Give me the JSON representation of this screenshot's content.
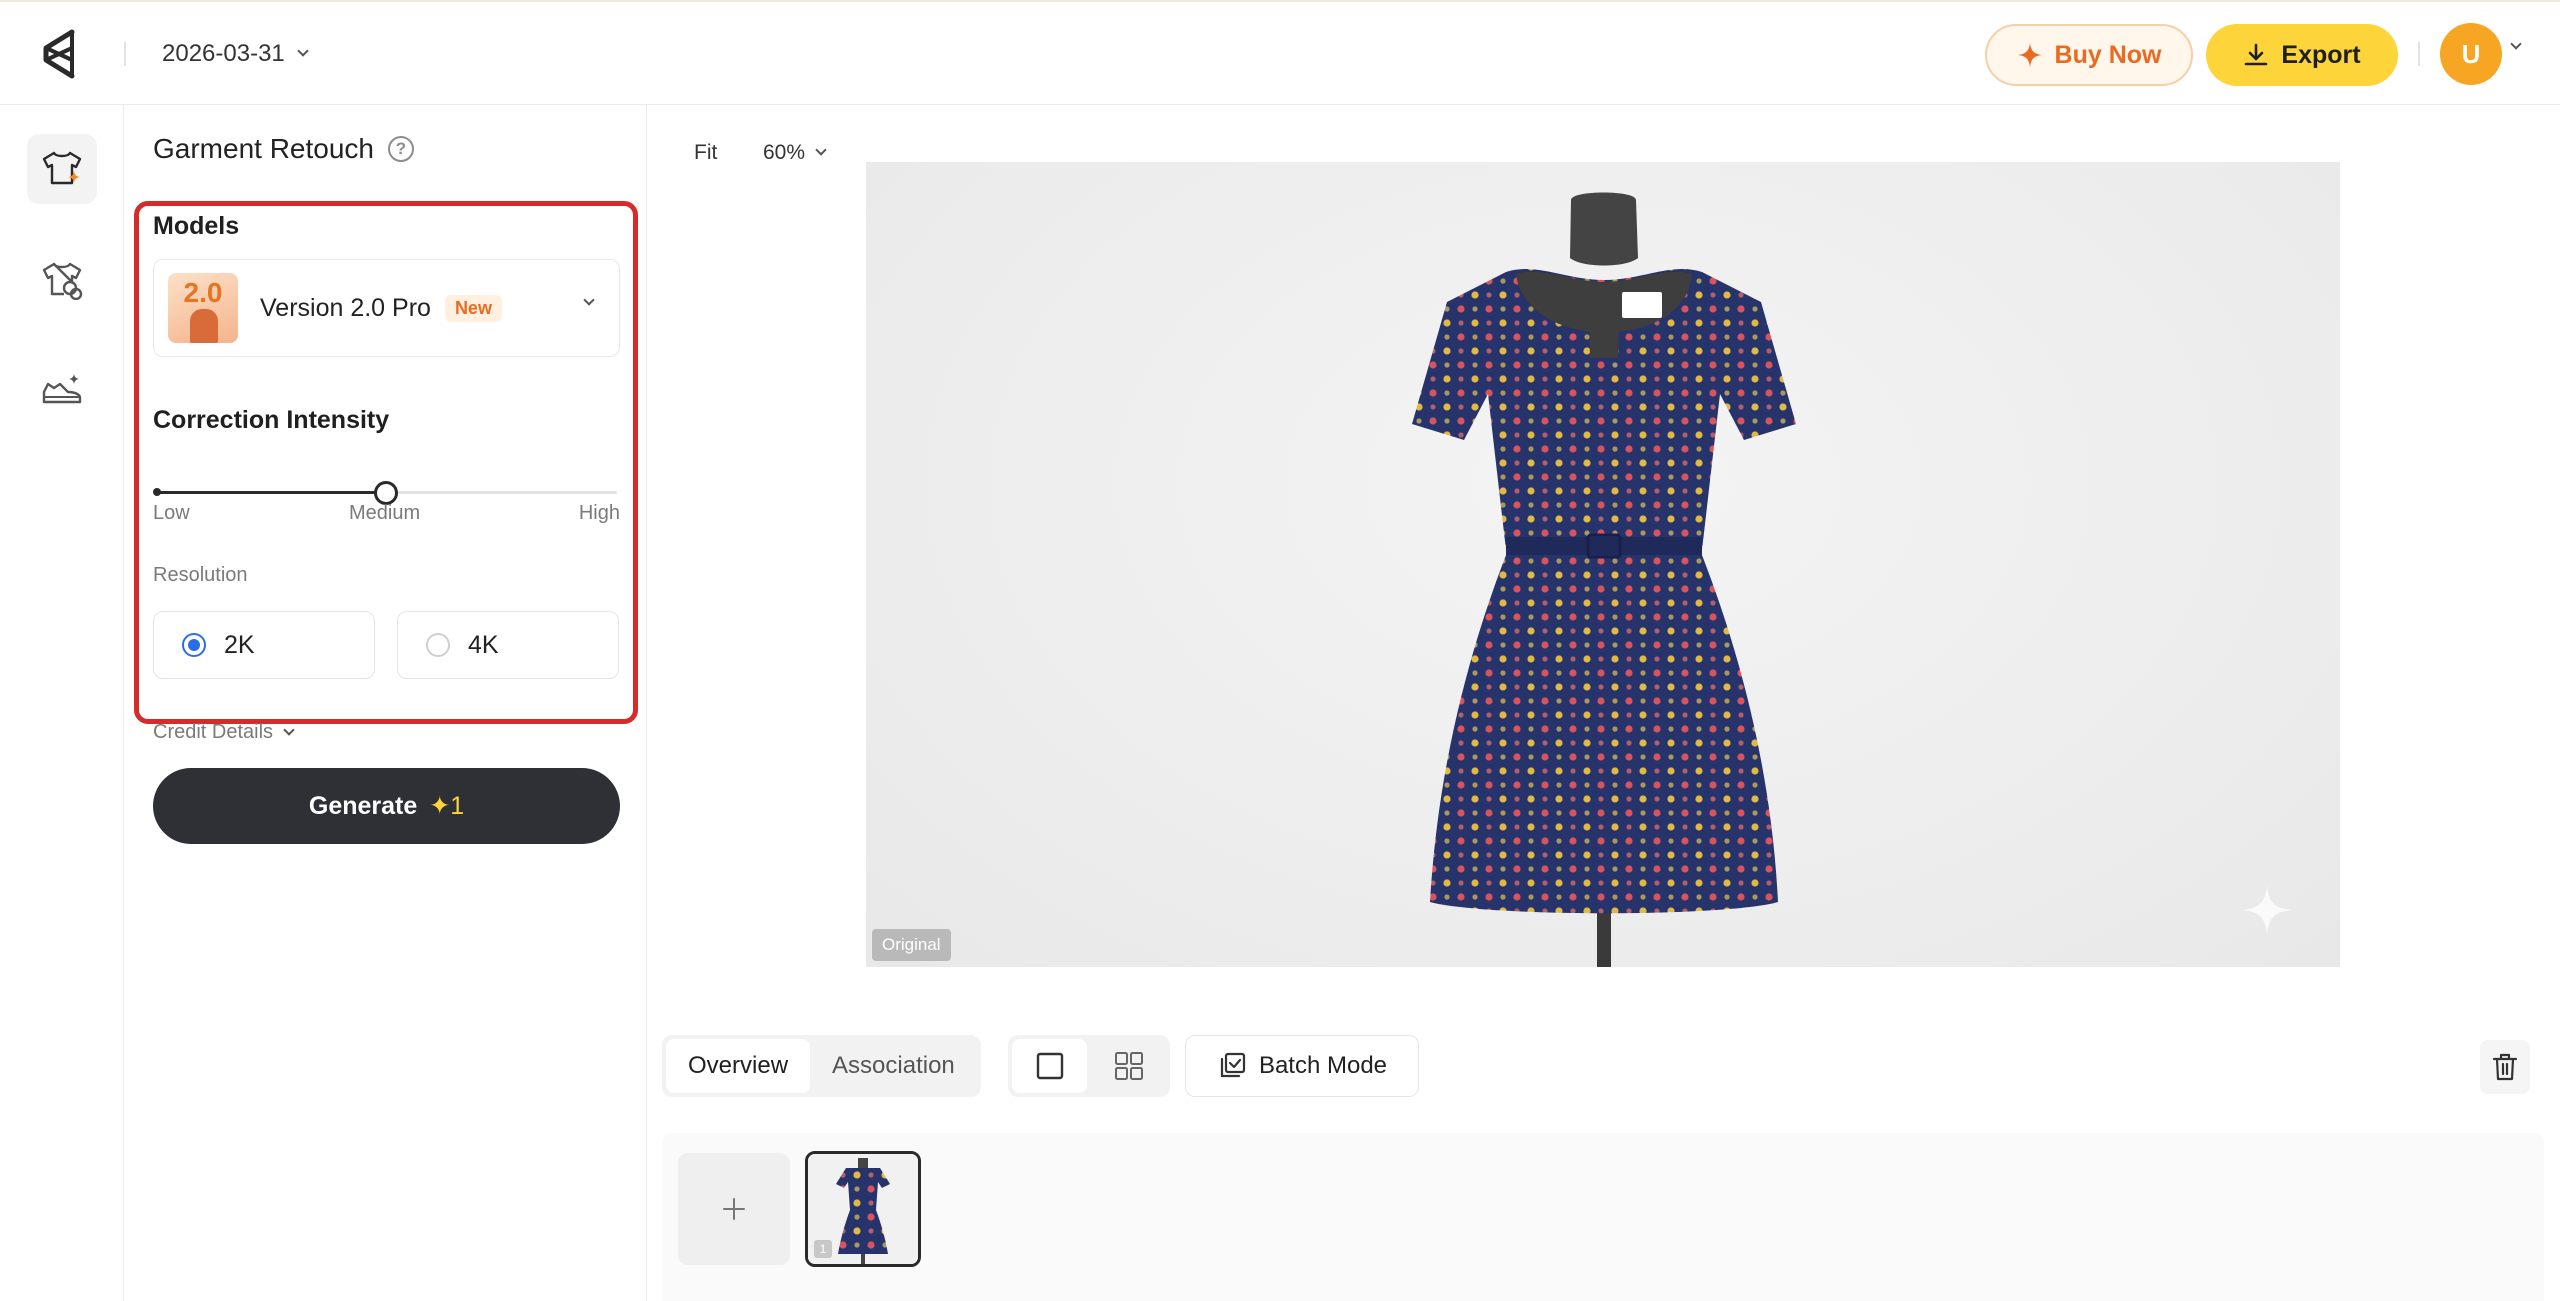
{
  "topbar": {
    "date": "2026-03-31",
    "buy_label": "Buy Now",
    "export_label": "Export",
    "avatar_initial": "U"
  },
  "rail": {
    "items": [
      {
        "icon": "garment-retouch-icon",
        "active": true
      },
      {
        "icon": "garment-swap-icon",
        "active": false
      },
      {
        "icon": "shoe-retouch-icon",
        "active": false
      }
    ]
  },
  "panel": {
    "title": "Garment Retouch",
    "help_glyph": "?",
    "models_label": "Models",
    "model": {
      "thumb_text": "2.0",
      "name": "Version 2.0 Pro",
      "badge": "New"
    },
    "intensity": {
      "label": "Correction Intensity",
      "low": "Low",
      "medium": "Medium",
      "high": "High",
      "value_fraction": 0.5
    },
    "resolution": {
      "label": "Resolution",
      "options": [
        "2K",
        "4K"
      ],
      "selected": "2K"
    },
    "credit_details": "Credit Details",
    "generate_label": "Generate",
    "generate_credit": "✦1"
  },
  "canvas": {
    "fit_label": "Fit",
    "zoom": "60%",
    "original_badge": "Original",
    "dress_colors": {
      "fabric": "#27336b",
      "dot_a": "#d7555e",
      "dot_b": "#e2b845",
      "form": "#3a3a3a"
    }
  },
  "bottom": {
    "tabs": [
      "Overview",
      "Association"
    ],
    "active_tab": "Overview",
    "batch_label": "Batch Mode",
    "thumb_number": "1"
  },
  "colors": {
    "accent_orange": "#ea6a1f",
    "export_yellow": "#fdd53a",
    "avatar": "#f6a623",
    "highlight_red": "#d52b2b",
    "radio_blue": "#2b6de8"
  }
}
